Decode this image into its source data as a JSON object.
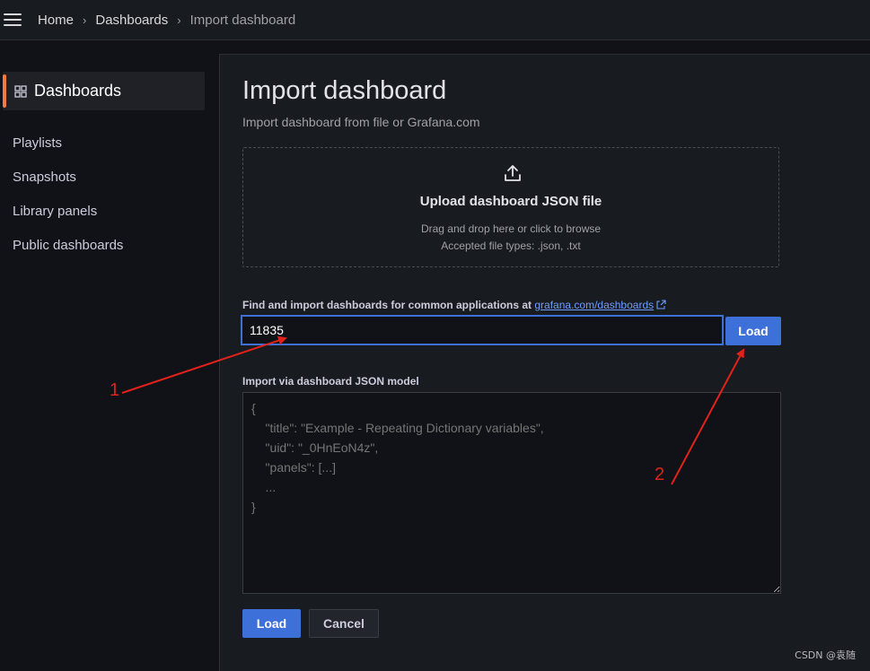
{
  "breadcrumb": {
    "home": "Home",
    "dashboards": "Dashboards",
    "current": "Import dashboard",
    "separator": "›"
  },
  "sidebar": {
    "title": "Dashboards",
    "items": [
      {
        "label": "Playlists"
      },
      {
        "label": "Snapshots"
      },
      {
        "label": "Library panels"
      },
      {
        "label": "Public dashboards"
      }
    ]
  },
  "main": {
    "title": "Import dashboard",
    "subtitle": "Import dashboard from file or Grafana.com",
    "upload": {
      "title": "Upload dashboard JSON file",
      "hint": "Drag and drop here or click to browse",
      "accepted": "Accepted file types: .json, .txt"
    },
    "find": {
      "label": "Find and import dashboards for common applications at",
      "link": "grafana.com/dashboards",
      "input_value": "11835",
      "load_label": "Load"
    },
    "json_model": {
      "label": "Import via dashboard JSON model",
      "placeholder": "{\n    \"title\": \"Example - Repeating Dictionary variables\",\n    \"uid\": \"_0HnEoN4z\",\n    \"panels\": [...]\n    ...\n}"
    },
    "buttons": {
      "load": "Load",
      "cancel": "Cancel"
    }
  },
  "annotations": {
    "one": "1",
    "two": "2"
  },
  "watermark": "CSDN @袁随",
  "colors": {
    "accent": "#3d71d9",
    "active_indicator": "#f47a3e",
    "link": "#6e9fff",
    "annotation": "#e0221b"
  },
  "icons": [
    "menu-icon",
    "grid-icon",
    "upload-icon",
    "external-link-icon"
  ]
}
